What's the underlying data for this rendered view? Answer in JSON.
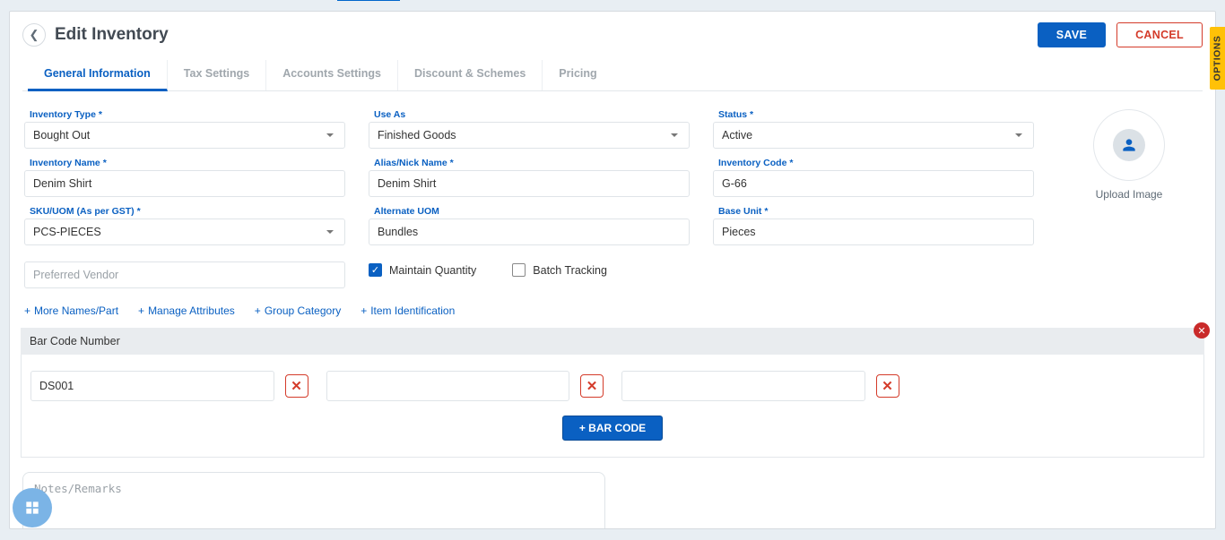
{
  "header": {
    "title": "Edit Inventory",
    "save": "SAVE",
    "cancel": "CANCEL"
  },
  "tabs": [
    "General Information",
    "Tax Settings",
    "Accounts Settings",
    "Discount & Schemes",
    "Pricing"
  ],
  "labels": {
    "inventory_type": "Inventory Type *",
    "use_as": "Use As",
    "status": "Status *",
    "inventory_name": "Inventory Name *",
    "alias": "Alias/Nick Name *",
    "inventory_code": "Inventory Code *",
    "sku": "SKU/UOM (As per GST) *",
    "alt_uom": "Alternate UOM",
    "base_unit": "Base Unit *",
    "preferred_vendor_ph": "Preferred Vendor",
    "maintain_qty": "Maintain Quantity",
    "batch_tracking": "Batch Tracking"
  },
  "values": {
    "inventory_type": "Bought Out",
    "use_as": "Finished Goods",
    "status": "Active",
    "inventory_name": "Denim Shirt",
    "alias": "Denim Shirt",
    "inventory_code": "G-66",
    "sku": "PCS-PIECES",
    "alt_uom": "Bundles",
    "base_unit": "Pieces",
    "preferred_vendor": "",
    "maintain_qty_checked": true,
    "batch_tracking_checked": false
  },
  "links": [
    "More Names/Part",
    "Manage Attributes",
    "Group Category",
    "Item Identification"
  ],
  "barcode": {
    "section_title": "Bar Code Number",
    "rows": [
      "DS001",
      "",
      ""
    ],
    "add_label": "+ BAR CODE"
  },
  "notes_ph": "Notes/Remarks",
  "upload_label": "Upload Image",
  "options_label": "OPTIONS"
}
